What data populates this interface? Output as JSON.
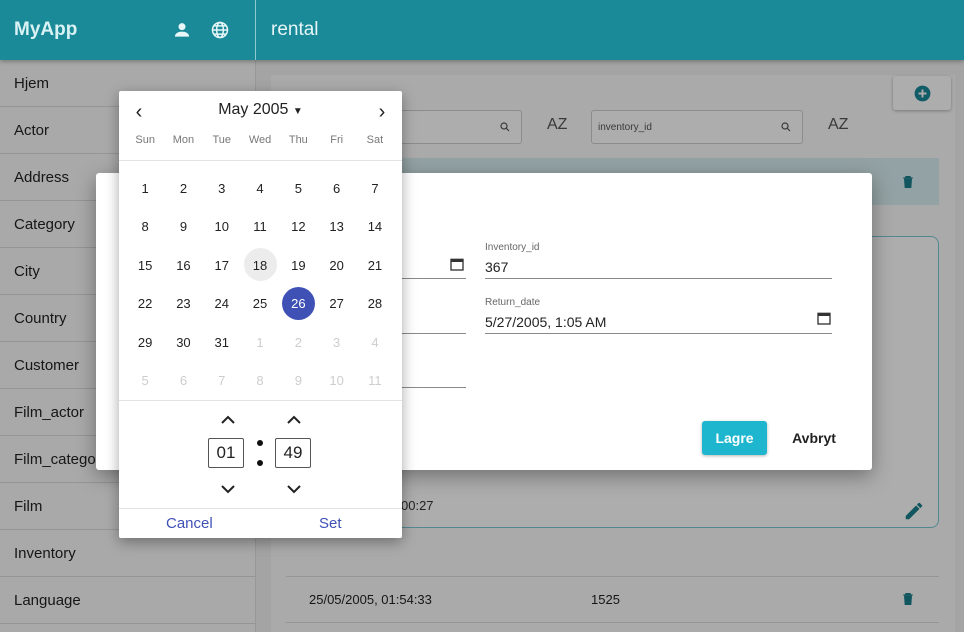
{
  "app": {
    "brand": "MyApp",
    "page_title": "rental"
  },
  "header_icons": [
    "person-icon",
    "globe-icon"
  ],
  "sidebar": {
    "items": [
      {
        "label": "Hjem"
      },
      {
        "label": "Actor"
      },
      {
        "label": "Address"
      },
      {
        "label": "Category"
      },
      {
        "label": "City"
      },
      {
        "label": "Country"
      },
      {
        "label": "Customer"
      },
      {
        "label": "Film_actor"
      },
      {
        "label": "Film_catego"
      },
      {
        "label": "Film"
      },
      {
        "label": "Inventory"
      },
      {
        "label": "Language"
      }
    ]
  },
  "toolbar": {
    "search2_placeholder": "inventory_id",
    "sort_label": "AZ"
  },
  "background_rows": {
    "detail_time": "00:27",
    "row": {
      "rental_date": "25/05/2005, 01:54:33",
      "inventory_id": "1525"
    }
  },
  "dialog": {
    "inventory_label": "Inventory_id",
    "inventory_value": "367",
    "return_label": "Return_date",
    "return_value": "5/27/2005, 1:05 AM",
    "save_label": "Lagre",
    "cancel_label": "Avbryt"
  },
  "picker": {
    "month_label": "May 2005",
    "weekdays": [
      "Sun",
      "Mon",
      "Tue",
      "Wed",
      "Thu",
      "Fri",
      "Sat"
    ],
    "weeks": [
      [
        {
          "d": "1"
        },
        {
          "d": "2"
        },
        {
          "d": "3"
        },
        {
          "d": "4"
        },
        {
          "d": "5"
        },
        {
          "d": "6"
        },
        {
          "d": "7"
        }
      ],
      [
        {
          "d": "8"
        },
        {
          "d": "9"
        },
        {
          "d": "10"
        },
        {
          "d": "11"
        },
        {
          "d": "12"
        },
        {
          "d": "13"
        },
        {
          "d": "14"
        }
      ],
      [
        {
          "d": "15"
        },
        {
          "d": "16"
        },
        {
          "d": "17"
        },
        {
          "d": "18",
          "today": true
        },
        {
          "d": "19"
        },
        {
          "d": "20"
        },
        {
          "d": "21"
        }
      ],
      [
        {
          "d": "22"
        },
        {
          "d": "23"
        },
        {
          "d": "24"
        },
        {
          "d": "25"
        },
        {
          "d": "26",
          "selected": true
        },
        {
          "d": "27"
        },
        {
          "d": "28"
        }
      ],
      [
        {
          "d": "29"
        },
        {
          "d": "30"
        },
        {
          "d": "31"
        },
        {
          "d": "1",
          "other": true
        },
        {
          "d": "2",
          "other": true
        },
        {
          "d": "3",
          "other": true
        },
        {
          "d": "4",
          "other": true
        }
      ],
      [
        {
          "d": "5",
          "other": true
        },
        {
          "d": "6",
          "other": true
        },
        {
          "d": "7",
          "other": true
        },
        {
          "d": "8",
          "other": true
        },
        {
          "d": "9",
          "other": true
        },
        {
          "d": "10",
          "other": true
        },
        {
          "d": "11",
          "other": true
        }
      ]
    ],
    "hour": "01",
    "minute": "49",
    "cancel_label": "Cancel",
    "set_label": "Set"
  },
  "colors": {
    "header": "#1a8a99",
    "accent": "#1eb6cf",
    "selected_day": "#3f51b5"
  }
}
